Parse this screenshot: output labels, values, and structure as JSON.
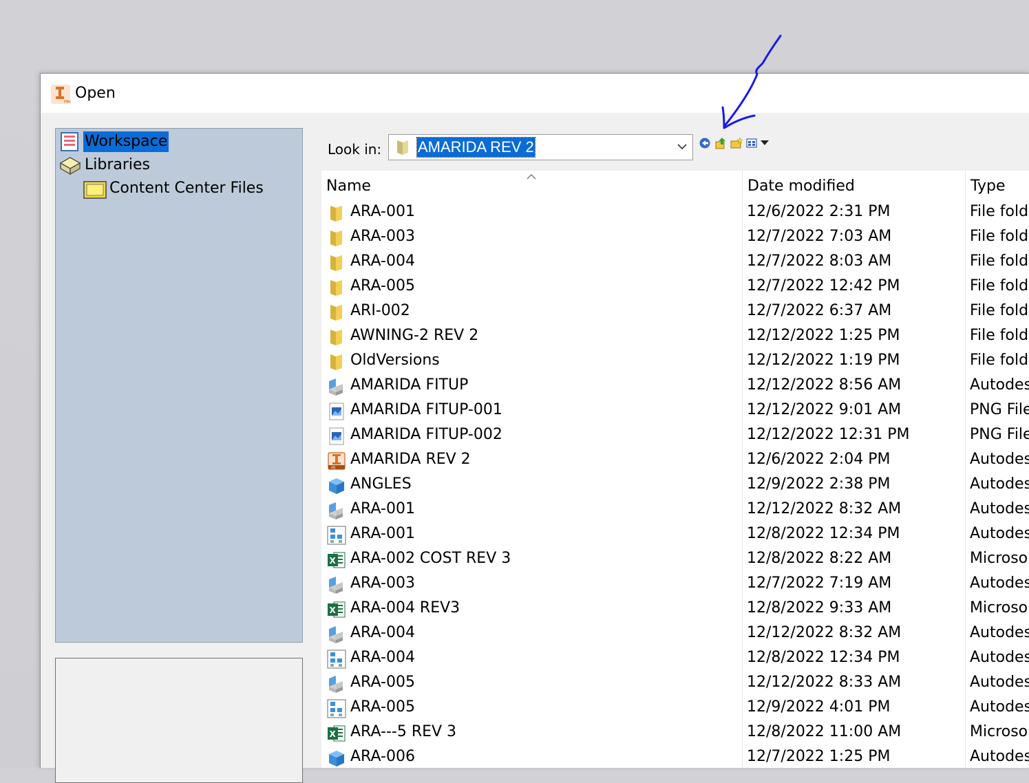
{
  "window": {
    "title": "Open",
    "app_icon": "autodesk-inventor-icon"
  },
  "places": [
    {
      "label": "Workspace",
      "icon": "workspace-icon",
      "selected": true
    },
    {
      "label": "Libraries",
      "icon": "libraries-icon",
      "selected": false
    },
    {
      "label": "Content Center Files",
      "icon": "folder-icon",
      "selected": false
    }
  ],
  "lookin": {
    "label": "Look in:",
    "value": "AMARIDA REV 2"
  },
  "toolbar": [
    "back-icon",
    "up-folder-icon",
    "new-folder-icon",
    "view-menu-icon"
  ],
  "columns": {
    "name": "Name",
    "date": "Date modified",
    "type": "Type"
  },
  "files": [
    {
      "name": "ARA-001",
      "date": "12/6/2022 2:31 PM",
      "type": "File fold",
      "icon": "folder"
    },
    {
      "name": "ARA-003",
      "date": "12/7/2022 7:03 AM",
      "type": "File fold",
      "icon": "folder"
    },
    {
      "name": "ARA-004",
      "date": "12/7/2022 8:03 AM",
      "type": "File fold",
      "icon": "folder"
    },
    {
      "name": "ARA-005",
      "date": "12/7/2022 12:42 PM",
      "type": "File fold",
      "icon": "folder"
    },
    {
      "name": "ARI-002",
      "date": "12/7/2022 6:37 AM",
      "type": "File fold",
      "icon": "folder"
    },
    {
      "name": "AWNING-2 REV 2",
      "date": "12/12/2022 1:25 PM",
      "type": "File fold",
      "icon": "folder"
    },
    {
      "name": "OldVersions",
      "date": "12/12/2022 1:19 PM",
      "type": "File fold",
      "icon": "folder"
    },
    {
      "name": "AMARIDA FITUP",
      "date": "12/12/2022 8:56 AM",
      "type": "Autodes",
      "icon": "assembly"
    },
    {
      "name": "AMARIDA FITUP-001",
      "date": "12/12/2022 9:01 AM",
      "type": "PNG File",
      "icon": "image"
    },
    {
      "name": "AMARIDA FITUP-002",
      "date": "12/12/2022 12:31 PM",
      "type": "PNG File",
      "icon": "image"
    },
    {
      "name": "AMARIDA REV 2",
      "date": "12/6/2022 2:04 PM",
      "type": "Autodes",
      "icon": "project"
    },
    {
      "name": "ANGLES",
      "date": "12/9/2022 2:38 PM",
      "type": "Autodes",
      "icon": "part"
    },
    {
      "name": "ARA-001",
      "date": "12/12/2022 8:32 AM",
      "type": "Autodes",
      "icon": "assembly"
    },
    {
      "name": "ARA-001",
      "date": "12/8/2022 12:34 PM",
      "type": "Autodes",
      "icon": "presentation"
    },
    {
      "name": "ARA-002 COST REV 3",
      "date": "12/8/2022 8:22 AM",
      "type": "Microso",
      "icon": "excel"
    },
    {
      "name": "ARA-003",
      "date": "12/7/2022 7:19 AM",
      "type": "Autodes",
      "icon": "assembly"
    },
    {
      "name": "ARA-004 REV3",
      "date": "12/8/2022 9:33 AM",
      "type": "Microso",
      "icon": "excel"
    },
    {
      "name": "ARA-004",
      "date": "12/12/2022 8:32 AM",
      "type": "Autodes",
      "icon": "assembly"
    },
    {
      "name": "ARA-004",
      "date": "12/8/2022 12:34 PM",
      "type": "Autodes",
      "icon": "presentation"
    },
    {
      "name": "ARA-005",
      "date": "12/12/2022 8:33 AM",
      "type": "Autodes",
      "icon": "assembly"
    },
    {
      "name": "ARA-005",
      "date": "12/9/2022 4:01 PM",
      "type": "Autodes",
      "icon": "presentation"
    },
    {
      "name": "ARA---5 REV 3",
      "date": "12/8/2022 11:00 AM",
      "type": "Microso",
      "icon": "excel"
    },
    {
      "name": "ARA-006",
      "date": "12/7/2022 1:25 PM",
      "type": "Autodes",
      "icon": "part"
    }
  ],
  "annotation": {
    "color": "#1a1ae6"
  },
  "colors": {
    "selection": "#0a6cd6",
    "places_bg": "#bdcad9",
    "folder": "#f5c842"
  }
}
